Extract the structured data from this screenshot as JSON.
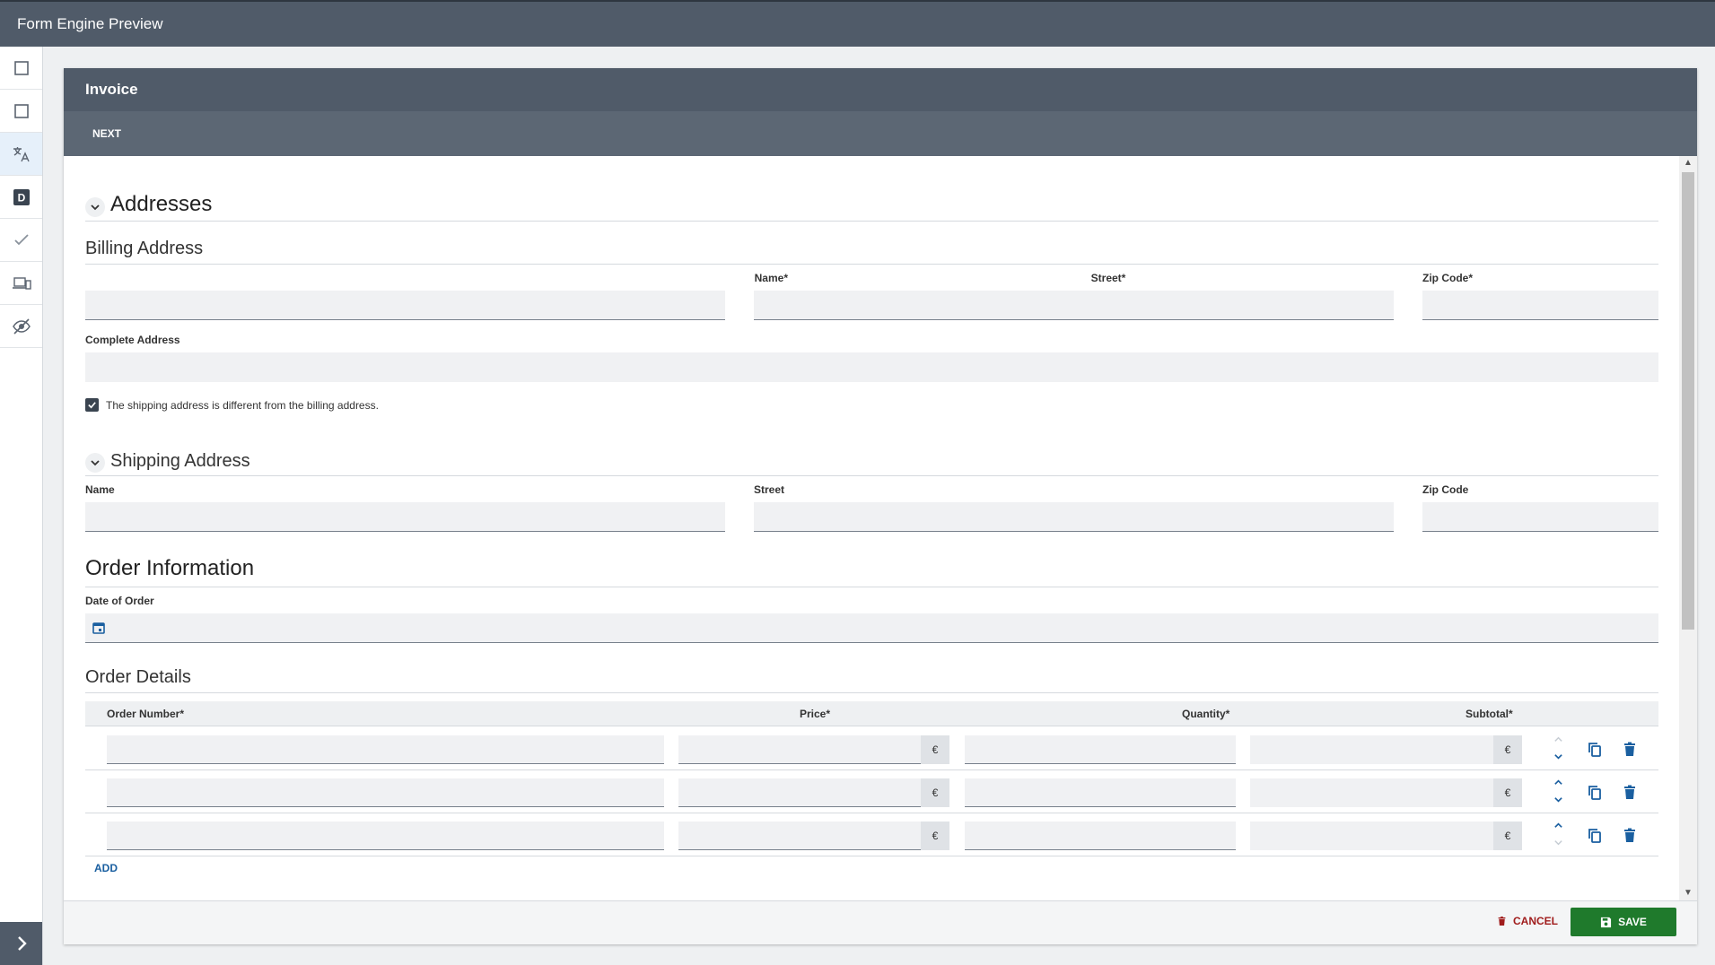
{
  "app": {
    "title": "Form Engine Preview"
  },
  "form": {
    "title": "Invoice",
    "next_label": "NEXT",
    "sections": {
      "addresses": {
        "title": "Addresses"
      },
      "billing": {
        "title": "Billing Address",
        "name_label": "Name*",
        "street_label": "Street*",
        "zip_label": "Zip Code*",
        "complete_label": "Complete Address"
      },
      "shipping_checkbox": {
        "label": "The shipping address is different from the billing address.",
        "checked": true
      },
      "shipping": {
        "title": "Shipping Address",
        "name_label": "Name",
        "street_label": "Street",
        "zip_label": "Zip Code"
      },
      "order_info": {
        "title": "Order Information",
        "date_label": "Date of Order"
      },
      "order_details": {
        "title": "Order Details",
        "columns": [
          "Order Number*",
          "Price*",
          "Quantity*",
          "Subtotal*"
        ],
        "currency": "€",
        "rows": 3,
        "add_label": "ADD"
      }
    }
  },
  "footer": {
    "cancel_label": "CANCEL",
    "save_label": "SAVE"
  },
  "colors": {
    "header": "#505b69",
    "accent": "#1a5fa0",
    "save": "#1f7a2c",
    "cancel": "#a01c1c"
  }
}
